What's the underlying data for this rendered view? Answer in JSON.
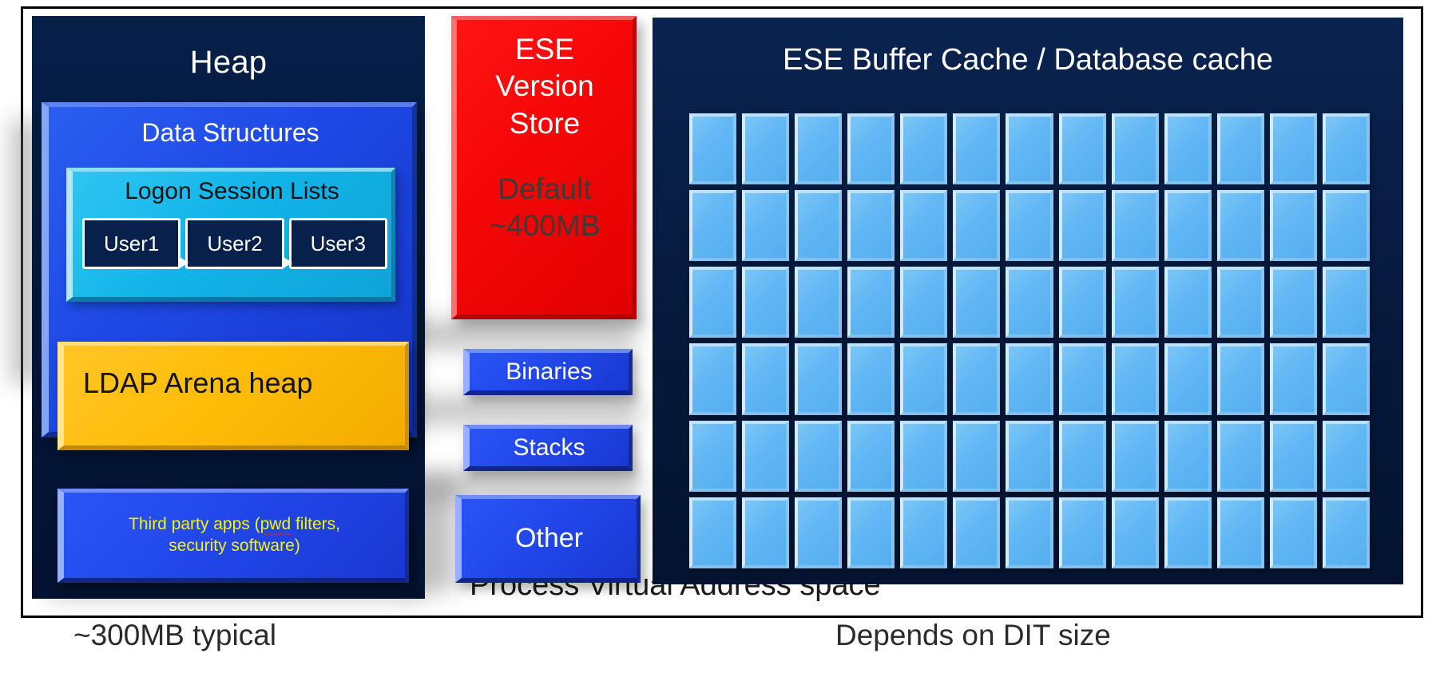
{
  "frame": {
    "present": true
  },
  "heap": {
    "title": "Heap",
    "data_structures": {
      "label": "Data Structures",
      "logon_session_lists": {
        "label": "Logon Session Lists",
        "users": [
          "User1",
          "User2",
          "User3"
        ]
      }
    },
    "ldap_arena_heap": {
      "label": "LDAP Arena heap"
    },
    "third_party_apps": {
      "line1_before": "Third party apps (",
      "line1_misspelled": "pwd",
      "line1_after": " filters,",
      "line2": "security software)"
    }
  },
  "ese_version_store": {
    "title_line1": "ESE",
    "title_line2": "Version",
    "title_line3": "Store",
    "sub_line1": "Default",
    "sub_line2": "~400MB"
  },
  "small_boxes": [
    {
      "label": "Binaries"
    },
    {
      "label": "Stacks"
    },
    {
      "label": "Other"
    }
  ],
  "cache": {
    "title": "ESE Buffer Cache / Database cache",
    "columns": 13,
    "rows": 6
  },
  "process_label": "Process Virtual Address space",
  "captions": {
    "left": "~300MB typical",
    "right": "Depends on DIT size"
  },
  "colors": {
    "heap_panel": "#072049",
    "data_structures": "#2147ea",
    "logon_box": "#12b4e8",
    "user_box": "#07204c",
    "ldap_box": "#ffbd09",
    "third_party_text": "#f7f30b",
    "spell_error_underline": "#e02020",
    "ese_version_store": "#f60707",
    "ese_version_sub_text": "#3b3b3b",
    "small_box": "#2147ea",
    "cache_panel": "#06193c",
    "cache_tile": "#62b8f4",
    "page_background": "#ffffff",
    "frame_border": "#000000",
    "caption_text": "#2b2b2b"
  }
}
